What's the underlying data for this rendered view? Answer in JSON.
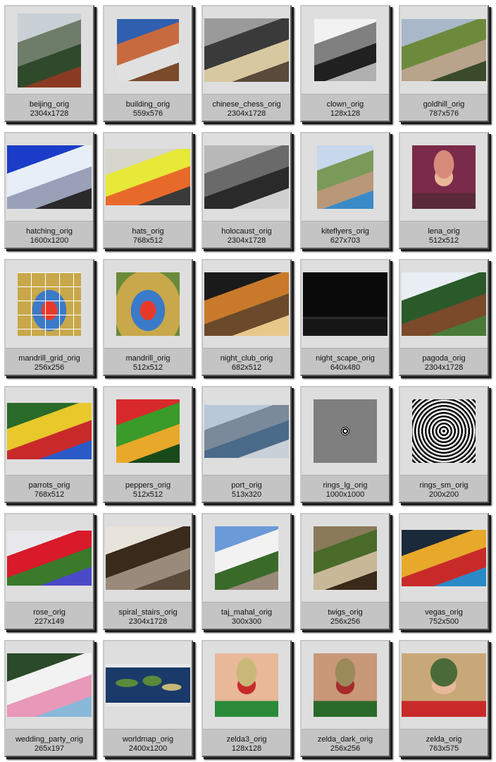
{
  "images": [
    {
      "name": "beijing_orig",
      "size": "2304x1728",
      "icon": "city-temple-photo",
      "colors": [
        "#c9d1d6",
        "#6e7c6a",
        "#2f4a2b",
        "#8a3a22"
      ]
    },
    {
      "name": "building_orig",
      "size": "559x576",
      "icon": "building-photo",
      "colors": [
        "#2f5fae",
        "#c86a3f",
        "#e0e0e0",
        "#7a4a2a"
      ]
    },
    {
      "name": "chinese_chess_orig",
      "size": "2304x1728",
      "icon": "chess-players-photo",
      "colors": [
        "#9a9a9a",
        "#3a3a3a",
        "#d8c8a0",
        "#5a4a3a"
      ]
    },
    {
      "name": "clown_orig",
      "size": "128x128",
      "icon": "clown-face-photo",
      "colors": [
        "#f2f2f2",
        "#808080",
        "#202020",
        "#b0b0b0"
      ]
    },
    {
      "name": "goldhill_orig",
      "size": "787x576",
      "icon": "village-hill-photo",
      "colors": [
        "#a8b8c8",
        "#6d8a3c",
        "#b7a48a",
        "#3a4a2a"
      ]
    },
    {
      "name": "hatching_orig",
      "size": "1600x1200",
      "icon": "penguin-render",
      "colors": [
        "#1a3cc8",
        "#e8eef8",
        "#9aa0b8",
        "#2a2a2a"
      ]
    },
    {
      "name": "hats_orig",
      "size": "768x512",
      "icon": "colored-hats-photo",
      "colors": [
        "#d6d6cc",
        "#e8e838",
        "#e86a2a",
        "#3a3a3a"
      ]
    },
    {
      "name": "holocaust_orig",
      "size": "2304x1728",
      "icon": "memorial-blocks-photo",
      "colors": [
        "#b8b8b8",
        "#6a6a6a",
        "#2a2a2a",
        "#d0d0d0"
      ]
    },
    {
      "name": "kiteflyers_orig",
      "size": "627x703",
      "icon": "kite-flyers-photo",
      "colors": [
        "#c8d8ec",
        "#7a9a5a",
        "#b89878",
        "#3a8ac8"
      ]
    },
    {
      "name": "lena_orig",
      "size": "512x512",
      "icon": "portrait-photo",
      "colors": [
        "#d88a7a",
        "#7a2a4a",
        "#e8b898",
        "#5a2a3a"
      ]
    },
    {
      "name": "mandrill_grid_orig",
      "size": "256x256",
      "icon": "mandrill-grid-photo",
      "colors": [
        "#3a7ac8",
        "#e83a2a",
        "#c8a84a",
        "#ffffff"
      ]
    },
    {
      "name": "mandrill_orig",
      "size": "512x512",
      "icon": "mandrill-photo",
      "colors": [
        "#3a7ac8",
        "#e83a2a",
        "#c8a84a",
        "#6a8a3a"
      ]
    },
    {
      "name": "night_club_orig",
      "size": "682x512",
      "icon": "band-on-stage-photo",
      "colors": [
        "#1a1a1a",
        "#c87a2a",
        "#6a4a2a",
        "#e8c88a"
      ]
    },
    {
      "name": "night_scape_orig",
      "size": "640x480",
      "icon": "night-landscape-photo",
      "colors": [
        "#0a0a0a",
        "#161616",
        "#2a2a2a",
        "#3a3020"
      ]
    },
    {
      "name": "pagoda_orig",
      "size": "2304x1728",
      "icon": "pagoda-photo",
      "colors": [
        "#e8eef4",
        "#2a5a2a",
        "#7a4a2a",
        "#4a7a3a"
      ]
    },
    {
      "name": "parrots_orig",
      "size": "768x512",
      "icon": "parrots-photo",
      "colors": [
        "#2a6a2a",
        "#e8c82a",
        "#c82a2a",
        "#2a5ac8"
      ]
    },
    {
      "name": "peppers_orig",
      "size": "512x512",
      "icon": "peppers-photo",
      "colors": [
        "#d82a2a",
        "#3a9a2a",
        "#e8a82a",
        "#1a4a1a"
      ]
    },
    {
      "name": "port_orig",
      "size": "513x320",
      "icon": "harbor-skyline-photo",
      "colors": [
        "#b8c8d8",
        "#7a8a9a",
        "#4a6a8a",
        "#c8d0d8"
      ]
    },
    {
      "name": "rings_lg_orig",
      "size": "1000x1000",
      "icon": "single-ring-target",
      "colors": [
        "#7f7f7f",
        "#000000",
        "#ffffff",
        "#8a8a8a"
      ]
    },
    {
      "name": "rings_sm_orig",
      "size": "200x200",
      "icon": "concentric-rings-pattern",
      "colors": [
        "#7f7f7f",
        "#000000",
        "#ffffff",
        "#555555"
      ]
    },
    {
      "name": "rose_orig",
      "size": "227x149",
      "icon": "rose-photo",
      "colors": [
        "#e8e8ec",
        "#d81a2a",
        "#3a7a2a",
        "#4a4ac8"
      ]
    },
    {
      "name": "spiral_stairs_orig",
      "size": "2304x1728",
      "icon": "spiral-staircase-photo",
      "colors": [
        "#e8e4dc",
        "#3a2a1a",
        "#9a8a7a",
        "#5a4a3a"
      ]
    },
    {
      "name": "taj_mahal_orig",
      "size": "300x300",
      "icon": "taj-mahal-photo",
      "colors": [
        "#6a9ad8",
        "#f2f2f2",
        "#3a6a2a",
        "#9a8a7a"
      ]
    },
    {
      "name": "twigs_orig",
      "size": "256x256",
      "icon": "twigs-photo",
      "colors": [
        "#8a7a5a",
        "#4a6a2a",
        "#c8b898",
        "#3a2a1a"
      ]
    },
    {
      "name": "vegas_orig",
      "size": "752x500",
      "icon": "carnival-stand-photo",
      "colors": [
        "#1a2a3a",
        "#e8a82a",
        "#c82a2a",
        "#2a8ac8"
      ]
    },
    {
      "name": "wedding_party_orig",
      "size": "265x197",
      "icon": "wedding-limo-photo",
      "colors": [
        "#2a4a2a",
        "#f2f2f2",
        "#e898b8",
        "#8ab8d8"
      ]
    },
    {
      "name": "worldmap_orig",
      "size": "2400x1200",
      "icon": "world-map",
      "colors": [
        "#1a3a6a",
        "#5a8a3a",
        "#c8b878",
        "#e8e8e8"
      ]
    },
    {
      "name": "zelda3_orig",
      "size": "128x128",
      "icon": "portrait-photo",
      "colors": [
        "#c8b878",
        "#e8b898",
        "#c82a2a",
        "#2a8a3a"
      ]
    },
    {
      "name": "zelda_dark_orig",
      "size": "256x256",
      "icon": "portrait-photo",
      "colors": [
        "#9a8a5a",
        "#c89878",
        "#a82a2a",
        "#2a6a2a"
      ]
    },
    {
      "name": "zelda_orig",
      "size": "763x575",
      "icon": "portrait-photo",
      "colors": [
        "#4a6a3a",
        "#c8a878",
        "#e8b898",
        "#c82a2a"
      ]
    }
  ]
}
